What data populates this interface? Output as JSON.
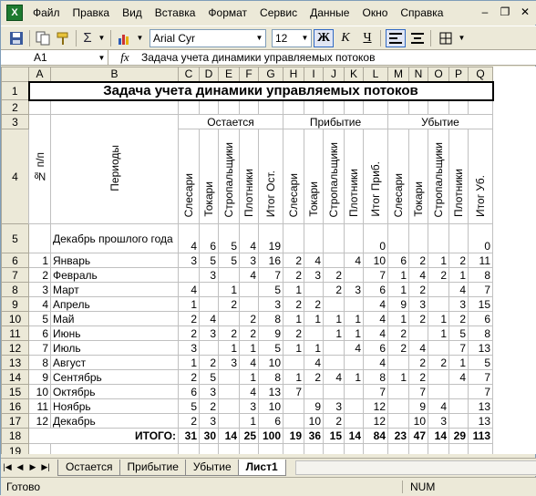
{
  "menu": {
    "items": [
      "Файл",
      "Правка",
      "Вид",
      "Вставка",
      "Формат",
      "Сервис",
      "Данные",
      "Окно",
      "Справка"
    ]
  },
  "toolbar": {
    "font": "Arial Cyr",
    "size": "12",
    "bold_label": "Ж",
    "italic_label": "К",
    "underline_label": "Ч",
    "sum_label": "Σ"
  },
  "formula_bar": {
    "name_box": "A1",
    "fx_label": "fx",
    "content": "Задача учета динамики управляемых потоков"
  },
  "sheet": {
    "columns": [
      "A",
      "B",
      "C",
      "D",
      "E",
      "F",
      "G",
      "H",
      "I",
      "J",
      "K",
      "L",
      "M",
      "N",
      "O",
      "P",
      "Q"
    ],
    "title": "Задача учета динамики управляемых потоков",
    "groups": [
      "Остается",
      "Прибытие",
      "Убытие"
    ],
    "header_np": "№ п/п",
    "header_periods": "Периоды",
    "subheaders": [
      "Слесари",
      "Токари",
      "Стропальщики",
      "Плотники",
      "Итог Ост.",
      "Слесари",
      "Токари",
      "Стропальщики",
      "Плотники",
      "Итог Приб.",
      "Слесари",
      "Токари",
      "Стропальщики",
      "Плотники",
      "Итог Уб."
    ],
    "rows": [
      {
        "n": "",
        "period": "Декабрь прошлого года",
        "v": [
          "4",
          "6",
          "5",
          "4",
          "19",
          "",
          "",
          "",
          "",
          "0",
          "",
          "",
          "",
          "",
          "0"
        ]
      },
      {
        "n": "1",
        "period": "Январь",
        "v": [
          "3",
          "5",
          "5",
          "3",
          "16",
          "2",
          "4",
          "",
          "4",
          "10",
          "6",
          "2",
          "1",
          "2",
          "11"
        ]
      },
      {
        "n": "2",
        "period": "Февраль",
        "v": [
          "",
          "3",
          "",
          "4",
          "7",
          "2",
          "3",
          "2",
          "",
          "7",
          "1",
          "4",
          "2",
          "1",
          "8"
        ]
      },
      {
        "n": "3",
        "period": "Март",
        "v": [
          "4",
          "",
          "1",
          "",
          "5",
          "1",
          "",
          "2",
          "3",
          "6",
          "1",
          "2",
          "",
          "4",
          "7"
        ]
      },
      {
        "n": "4",
        "period": "Апрель",
        "v": [
          "1",
          "",
          "2",
          "",
          "3",
          "2",
          "2",
          "",
          "",
          "4",
          "9",
          "3",
          "",
          "3",
          "15"
        ]
      },
      {
        "n": "5",
        "period": "Май",
        "v": [
          "2",
          "4",
          "",
          "2",
          "8",
          "1",
          "1",
          "1",
          "1",
          "4",
          "1",
          "2",
          "1",
          "2",
          "6"
        ]
      },
      {
        "n": "6",
        "period": "Июнь",
        "v": [
          "2",
          "3",
          "2",
          "2",
          "9",
          "2",
          "",
          "1",
          "1",
          "4",
          "2",
          "",
          "1",
          "5",
          "8"
        ]
      },
      {
        "n": "7",
        "period": "Июль",
        "v": [
          "3",
          "",
          "1",
          "1",
          "5",
          "1",
          "1",
          "",
          "4",
          "6",
          "2",
          "4",
          "",
          "7",
          "13"
        ]
      },
      {
        "n": "8",
        "period": "Август",
        "v": [
          "1",
          "2",
          "3",
          "4",
          "10",
          "",
          "4",
          "",
          "",
          "4",
          "",
          "2",
          "2",
          "1",
          "5"
        ]
      },
      {
        "n": "9",
        "period": "Сентябрь",
        "v": [
          "2",
          "5",
          "",
          "1",
          "8",
          "1",
          "2",
          "4",
          "1",
          "8",
          "1",
          "2",
          "",
          "4",
          "7"
        ]
      },
      {
        "n": "10",
        "period": "Октябрь",
        "v": [
          "6",
          "3",
          "",
          "4",
          "13",
          "7",
          "",
          "",
          "",
          "7",
          "",
          "7",
          "",
          "",
          "7"
        ]
      },
      {
        "n": "11",
        "period": "Ноябрь",
        "v": [
          "5",
          "2",
          "",
          "3",
          "10",
          "",
          "9",
          "3",
          "",
          "12",
          "",
          "9",
          "4",
          "",
          "13"
        ]
      },
      {
        "n": "12",
        "period": "Декабрь",
        "v": [
          "2",
          "3",
          "",
          "1",
          "6",
          "",
          "10",
          "2",
          "",
          "12",
          "",
          "10",
          "3",
          "",
          "13"
        ]
      }
    ],
    "total_label": "ИТОГО:",
    "totals": [
      "31",
      "30",
      "14",
      "25",
      "100",
      "19",
      "36",
      "15",
      "14",
      "84",
      "23",
      "47",
      "14",
      "29",
      "113"
    ]
  },
  "tabs": [
    "Остается",
    "Прибытие",
    "Убытие",
    "Лист1"
  ],
  "active_tab": "Лист1",
  "status": {
    "ready": "Готово",
    "num": "NUM"
  }
}
